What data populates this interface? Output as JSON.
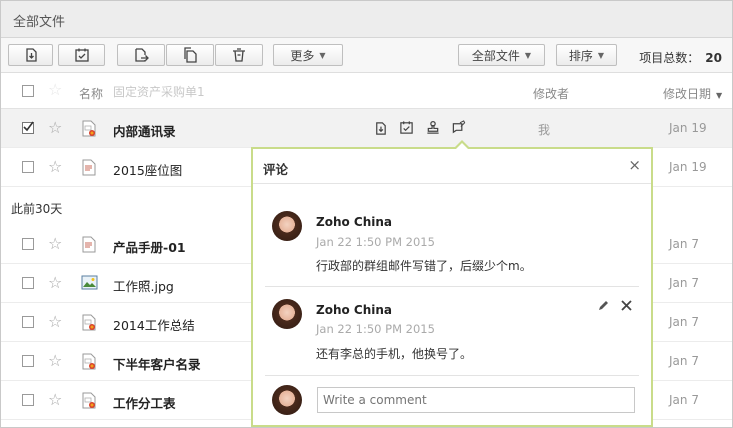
{
  "titlebar": {
    "title": "全部文件"
  },
  "toolbar": {
    "more_label": "更多",
    "all_files_label": "全部文件",
    "sort_label": "排序",
    "total_label": "项目总数：",
    "total_value": "20"
  },
  "columns": {
    "name": "名称",
    "modifier": "修改者",
    "date": "修改日期"
  },
  "ghost_text": "固定资产采购单1",
  "rows": [
    {
      "name": "内部通讯录",
      "modifier": "我",
      "date": "Jan 19"
    },
    {
      "name": "2015座位图",
      "date": "Jan 19"
    },
    {
      "name": "产品手册-01",
      "date": "Jan 7"
    },
    {
      "name": "工作照.jpg",
      "date": "Jan 7"
    },
    {
      "name": "2014工作总结",
      "date": "Jan 7"
    },
    {
      "name": "下半年客户名录",
      "date": "Jan 7"
    },
    {
      "name": "工作分工表",
      "date": "Jan 7"
    }
  ],
  "group_label": "此前30天",
  "comments": {
    "title": "评论",
    "close": "×",
    "items": [
      {
        "author": "Zoho China",
        "time": "Jan 22 1:50 PM 2015",
        "text": "行政部的群组邮件写错了，后缀少个m。"
      },
      {
        "author": "Zoho China",
        "time": "Jan 22 1:50 PM 2015",
        "text": "还有李总的手机，他换号了。"
      }
    ],
    "placeholder": "Write a comment"
  },
  "colors": {
    "popup_border": "#c9dc8a",
    "selected_row": "#f2f2f2",
    "file_red": "#d9412a",
    "file_orange": "#f2a01c"
  }
}
